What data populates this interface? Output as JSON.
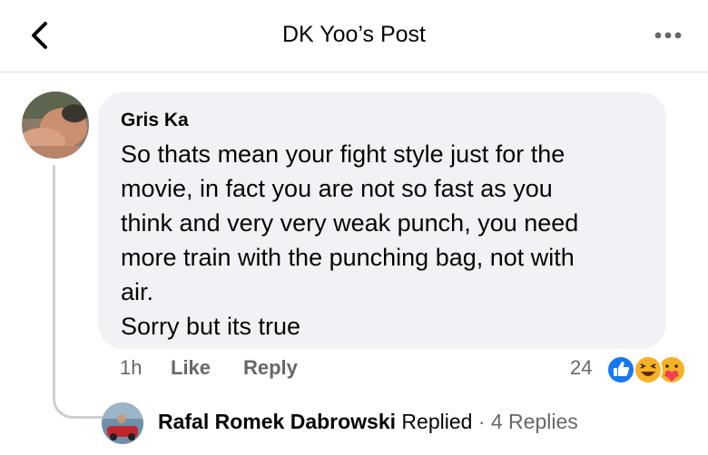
{
  "header": {
    "title": "DK Yoo’s Post",
    "back_icon": "chevron-left-icon",
    "more_icon": "more-dots-icon"
  },
  "comment": {
    "author": "Gris Ka",
    "text": "So thats mean your fight style just for the\nmovie, in fact you are not so fast as you\nthink and very very weak punch, you need\nmore train with the punching bag, not with\nair.\nSorry but its true",
    "time": "1h",
    "like_label": "Like",
    "reply_label": "Reply",
    "reaction_count": "24",
    "reactions": [
      "like-icon",
      "haha-icon",
      "care-icon"
    ],
    "bubble_color": "#f0f2f5"
  },
  "replies": {
    "name": "Rafal Romek Dabrowski",
    "replied": "Replied",
    "separator": "·",
    "count_label": "4 Replies"
  },
  "colors": {
    "secondary_text": "#65676b",
    "like_blue": "#1877f2",
    "reaction_yellow": "#f7b125"
  }
}
